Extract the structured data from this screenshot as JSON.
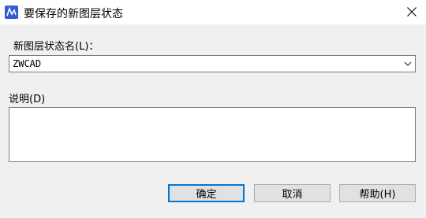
{
  "window": {
    "title": "要保存的新图层状态",
    "app_icon": "zwcad-app-icon",
    "close_icon": "close-icon"
  },
  "form": {
    "name_label": "新图层状态名(L)：",
    "name_value": "ZWCAD",
    "dropdown_icon": "chevron-down-icon",
    "desc_label": "说明(D)",
    "desc_value": ""
  },
  "buttons": {
    "ok": "确定",
    "cancel": "取消",
    "help": "帮助(H)"
  },
  "colors": {
    "accent": "#0078d7",
    "app_icon_bg": "#2f5fd0"
  }
}
